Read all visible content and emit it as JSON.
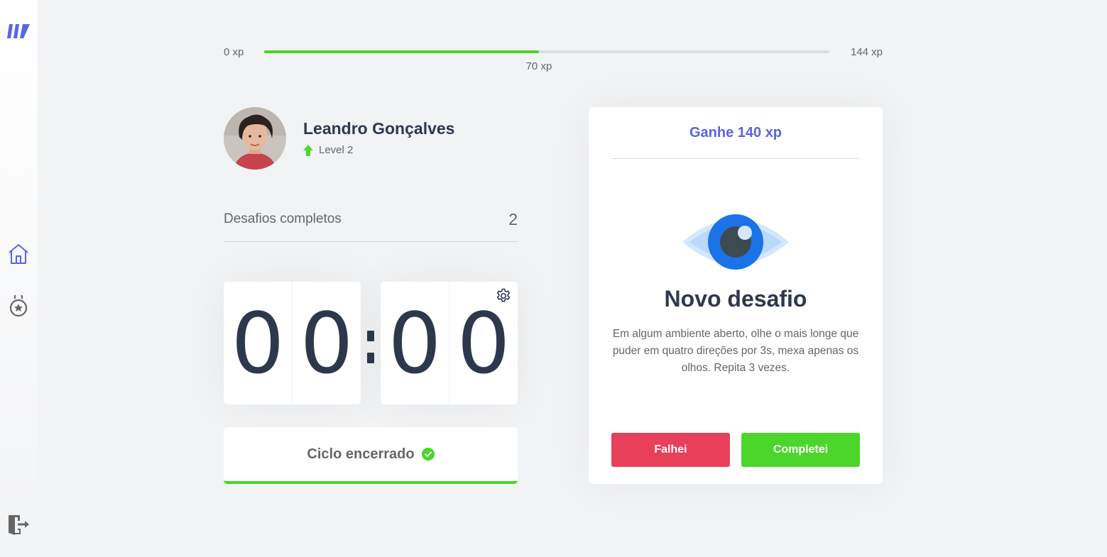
{
  "sidebar": {
    "logo_icon": "logo-icon",
    "items": [
      {
        "icon": "home-icon",
        "active": true
      },
      {
        "icon": "award-icon",
        "active": false
      }
    ],
    "logout_icon": "logout-icon"
  },
  "xp_bar": {
    "min_label": "0 xp",
    "max_label": "144 xp",
    "current_label": "70 xp",
    "current": 70,
    "max": 144,
    "fill_color": "#4cd62b"
  },
  "profile": {
    "name": "Leandro Gonçalves",
    "level": "Level 2",
    "level_icon": "level-up-arrow-icon"
  },
  "completed_challenges": {
    "label": "Desafios completos",
    "count": "2"
  },
  "countdown": {
    "minutes": [
      "0",
      "0"
    ],
    "seconds": [
      "0",
      "0"
    ],
    "settings_icon": "gear-icon"
  },
  "cycle_button": {
    "label": "Ciclo encerrado",
    "icon": "check-circle-icon",
    "accent": "#4cd62b"
  },
  "challenge": {
    "header": "Ganhe 140 xp",
    "icon": "eye-icon",
    "title": "Novo desafio",
    "description": "Em algum ambiente aberto, olhe o mais longe que puder em quatro direções por 3s, mexa apenas os olhos. Repita 3 vezes.",
    "fail_label": "Falhei",
    "success_label": "Completei",
    "fail_color": "#e83f5b",
    "success_color": "#4cd62b",
    "brand_color": "#5965e0"
  }
}
